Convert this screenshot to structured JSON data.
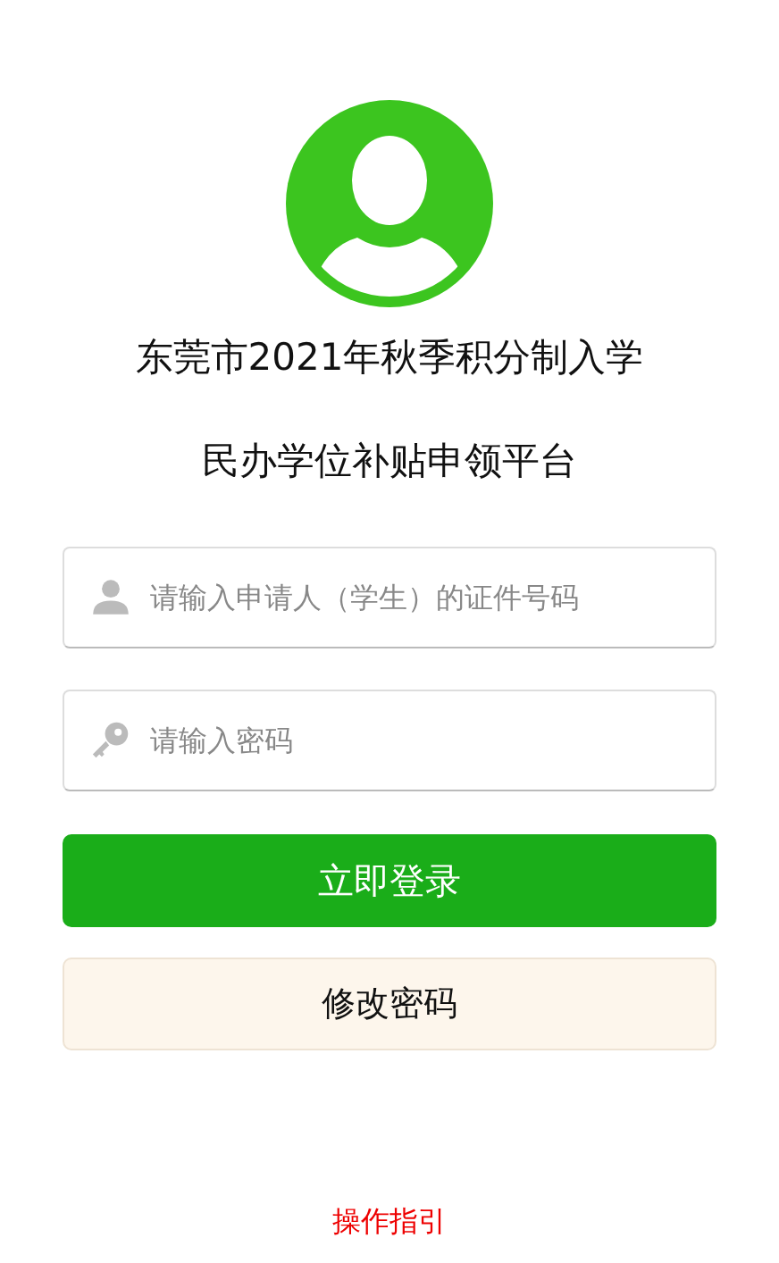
{
  "title_lines": [
    "东莞市2021年秋季积分制入学",
    "民办学位补贴申领平台"
  ],
  "fields": [
    {
      "kind": "user",
      "placeholder": "请输入申请人（学生）的证件号码"
    },
    {
      "kind": "password",
      "placeholder": "请输入密码"
    }
  ],
  "login_button": "立即登录",
  "change_password_button": "修改密码",
  "guide_link": "操作指引"
}
